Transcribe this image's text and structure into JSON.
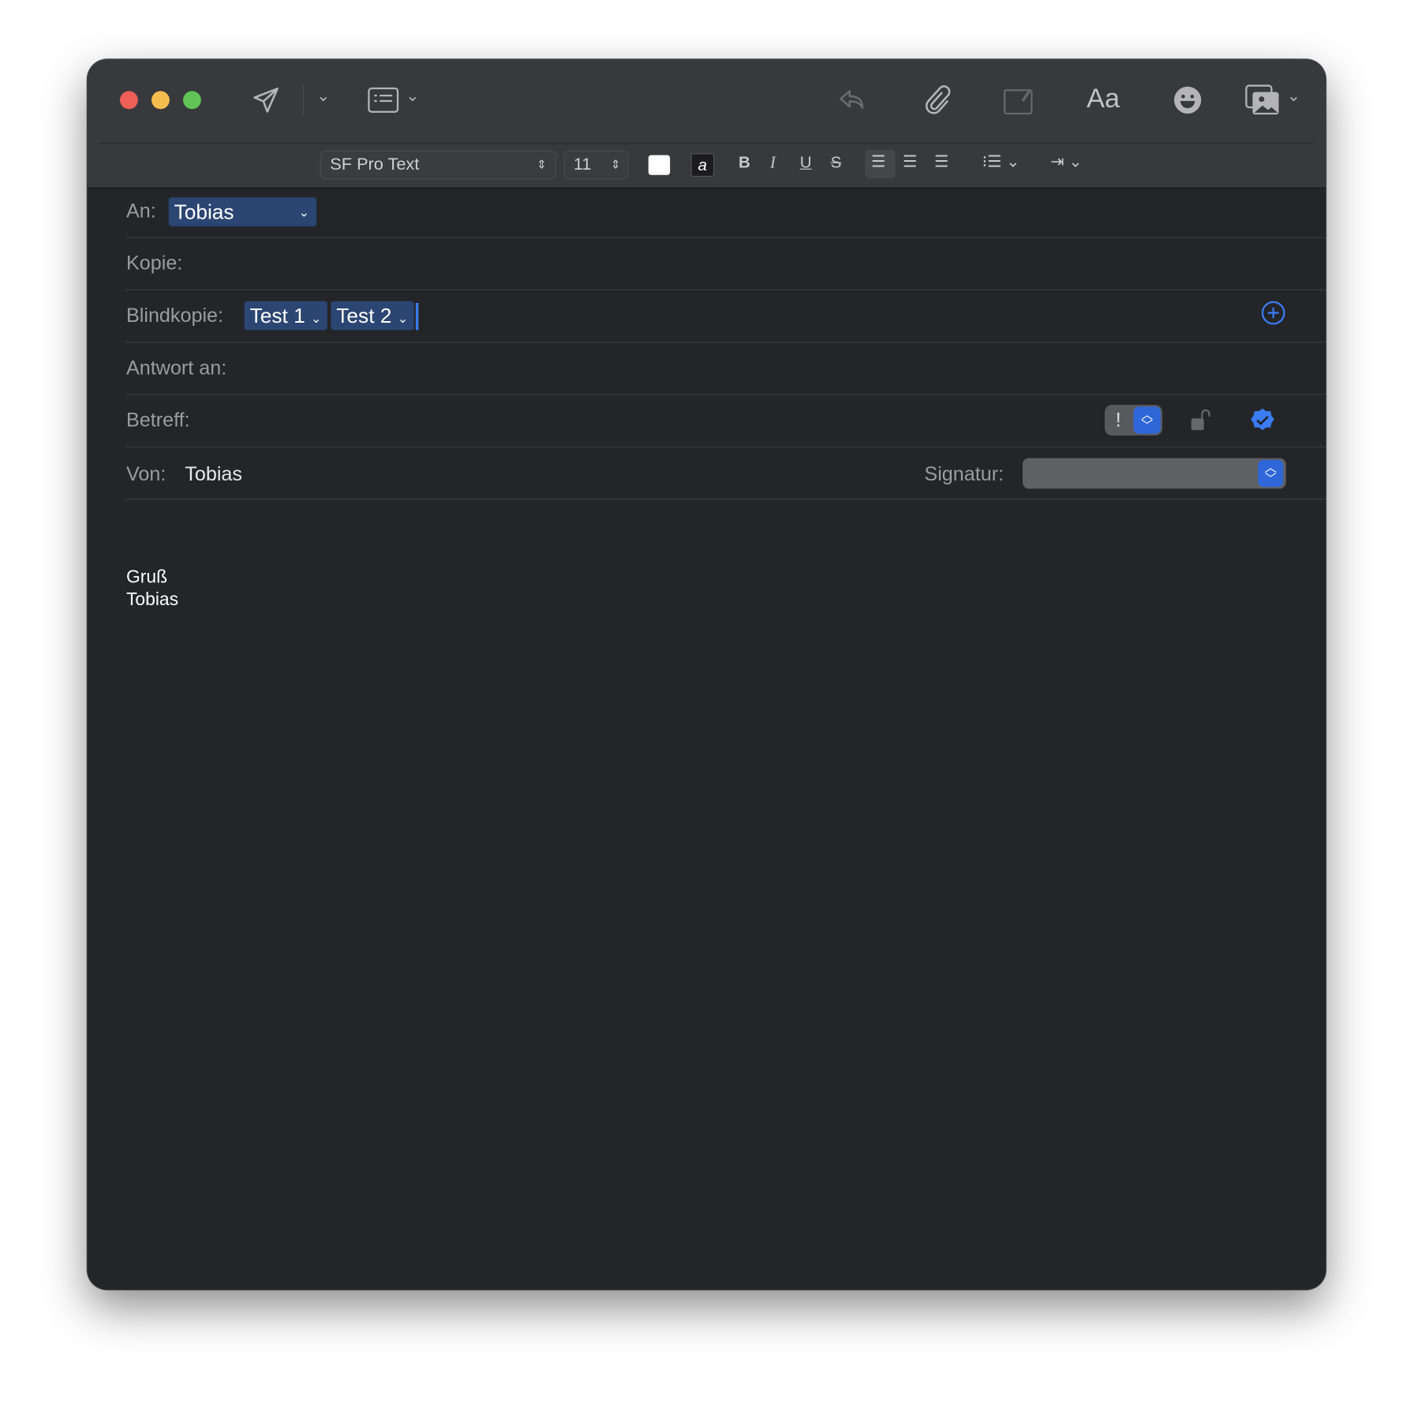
{
  "toolbar": {
    "font": "SF Pro Text",
    "size": "11",
    "bold": "B",
    "italic": "I",
    "underline": "U",
    "strike": "S",
    "format_icon": "Aa"
  },
  "fields": {
    "to_label": "An:",
    "to_token": "Tobias",
    "cc_label": "Kopie:",
    "bcc_label": "Blindkopie:",
    "bcc_tokens": [
      "Test 1",
      "Test 2"
    ],
    "reply_label": "Antwort an:",
    "subject_label": "Betreff:",
    "priority": "!",
    "from_label": "Von:",
    "from_value": "Tobias",
    "signature_label": "Signatur:"
  },
  "body": {
    "line1": "Gruß",
    "line2": "Tobias"
  },
  "colors": {
    "accent": "#2f67d8",
    "close": "#ed5f57",
    "minimize": "#f5bd4f",
    "zoom": "#5fc454"
  }
}
